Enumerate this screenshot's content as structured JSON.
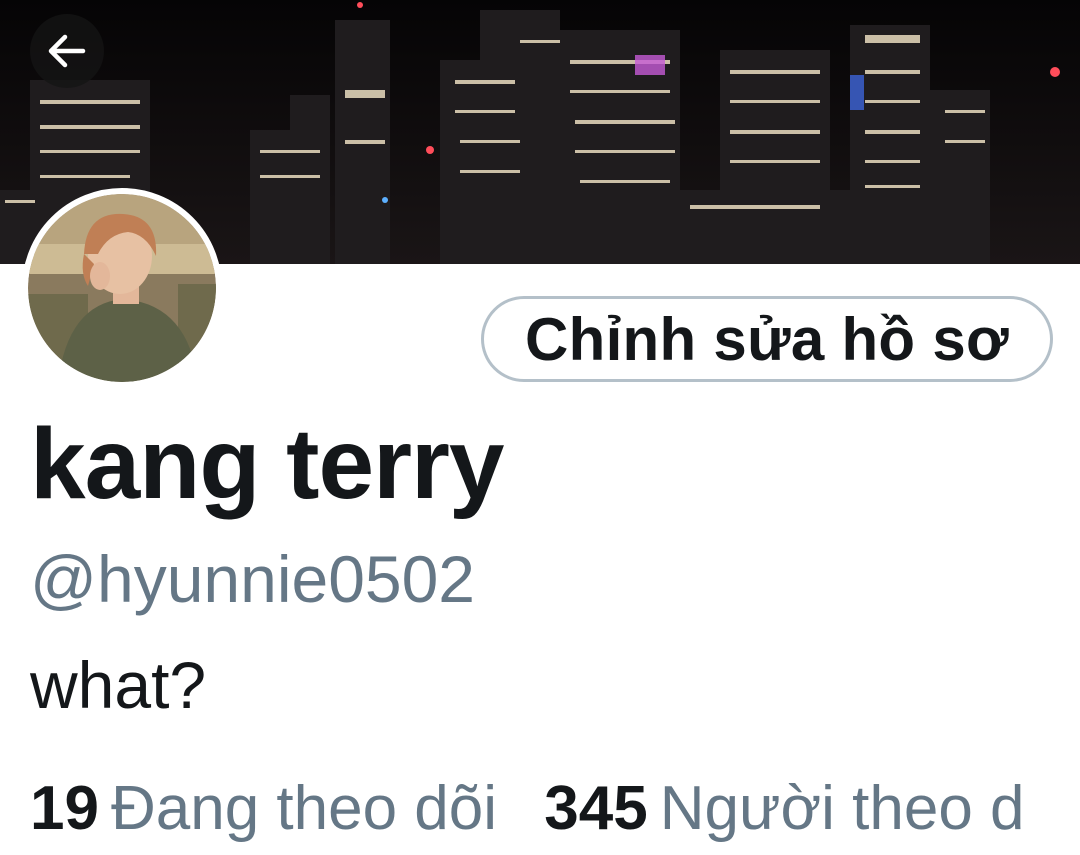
{
  "header": {
    "back_icon": "arrow-left-icon",
    "banner_image": "night city skyline"
  },
  "profile": {
    "avatar": "profile-photo",
    "edit_button_label": "Chỉnh sửa hồ sơ",
    "display_name": "kang terry",
    "handle": "@hyunnie0502",
    "bio": "what?"
  },
  "stats": {
    "following_count": "19",
    "following_label": "Đang theo dõi",
    "followers_count": "345",
    "followers_label": "Người theo d"
  },
  "colors": {
    "text_primary": "#14171a",
    "text_secondary": "#657786",
    "button_border": "#b4c0c9",
    "banner_bg": "#0c0a0b"
  }
}
